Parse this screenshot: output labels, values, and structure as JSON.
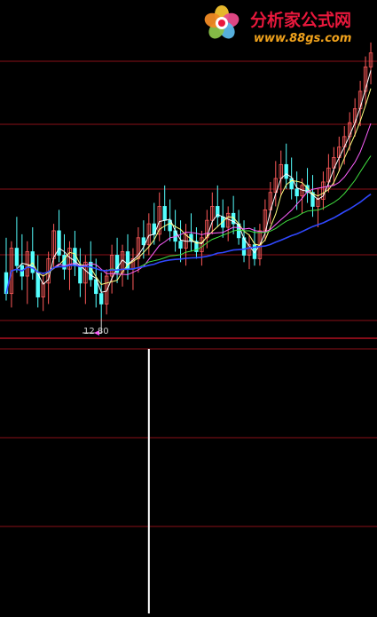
{
  "watermark": {
    "title": "分析家公式网",
    "url": "www.88gs.com",
    "colors": {
      "title": "#e8183c",
      "url": "#f0a21c"
    }
  },
  "chart_data": [
    {
      "type": "candlestick",
      "panel": "price",
      "annotation_low": {
        "value": 12.8,
        "text": "12.80"
      },
      "up_color": "#ff5a5a",
      "down_color": "#54ffff",
      "candles": [
        {
          "o": 14.1,
          "h": 15.1,
          "l": 13.3,
          "c": 13.5
        },
        {
          "o": 13.5,
          "h": 15.0,
          "l": 13.1,
          "c": 14.8
        },
        {
          "o": 14.8,
          "h": 15.7,
          "l": 14.1,
          "c": 14.3
        },
        {
          "o": 14.3,
          "h": 15.2,
          "l": 13.6,
          "c": 14.0
        },
        {
          "o": 14.0,
          "h": 15.0,
          "l": 13.2,
          "c": 14.7
        },
        {
          "o": 14.7,
          "h": 15.4,
          "l": 13.9,
          "c": 14.1
        },
        {
          "o": 14.1,
          "h": 14.6,
          "l": 13.1,
          "c": 13.4
        },
        {
          "o": 13.4,
          "h": 14.1,
          "l": 13.0,
          "c": 13.8
        },
        {
          "o": 13.8,
          "h": 14.7,
          "l": 13.2,
          "c": 14.5
        },
        {
          "o": 14.5,
          "h": 15.5,
          "l": 14.2,
          "c": 15.3
        },
        {
          "o": 15.3,
          "h": 15.9,
          "l": 14.4,
          "c": 14.6
        },
        {
          "o": 14.6,
          "h": 15.2,
          "l": 13.9,
          "c": 14.2
        },
        {
          "o": 14.2,
          "h": 15.0,
          "l": 13.6,
          "c": 14.8
        },
        {
          "o": 14.8,
          "h": 15.3,
          "l": 14.0,
          "c": 14.3
        },
        {
          "o": 14.3,
          "h": 14.8,
          "l": 13.4,
          "c": 13.8
        },
        {
          "o": 13.8,
          "h": 14.6,
          "l": 13.2,
          "c": 14.4
        },
        {
          "o": 14.4,
          "h": 15.0,
          "l": 13.7,
          "c": 13.9
        },
        {
          "o": 13.9,
          "h": 14.5,
          "l": 13.1,
          "c": 13.5
        },
        {
          "o": 13.5,
          "h": 14.1,
          "l": 12.8,
          "c": 13.2
        },
        {
          "o": 13.2,
          "h": 14.2,
          "l": 12.9,
          "c": 14.0
        },
        {
          "o": 14.0,
          "h": 14.9,
          "l": 13.5,
          "c": 14.6
        },
        {
          "o": 14.6,
          "h": 15.1,
          "l": 13.8,
          "c": 14.1
        },
        {
          "o": 14.1,
          "h": 14.9,
          "l": 13.7,
          "c": 14.7
        },
        {
          "o": 14.7,
          "h": 15.2,
          "l": 13.9,
          "c": 14.2
        },
        {
          "o": 14.2,
          "h": 14.8,
          "l": 13.6,
          "c": 14.5
        },
        {
          "o": 14.5,
          "h": 15.4,
          "l": 14.1,
          "c": 15.1
        },
        {
          "o": 15.1,
          "h": 15.6,
          "l": 14.5,
          "c": 14.9
        },
        {
          "o": 14.9,
          "h": 15.8,
          "l": 14.6,
          "c": 15.5
        },
        {
          "o": 15.5,
          "h": 16.1,
          "l": 14.9,
          "c": 15.2
        },
        {
          "o": 15.2,
          "h": 16.4,
          "l": 15.0,
          "c": 16.0
        },
        {
          "o": 16.0,
          "h": 16.6,
          "l": 15.3,
          "c": 15.6
        },
        {
          "o": 15.6,
          "h": 16.2,
          "l": 15.0,
          "c": 15.3
        },
        {
          "o": 15.3,
          "h": 15.9,
          "l": 14.7,
          "c": 15.0
        },
        {
          "o": 15.0,
          "h": 15.6,
          "l": 14.4,
          "c": 14.8
        },
        {
          "o": 14.8,
          "h": 15.5,
          "l": 14.3,
          "c": 15.2
        },
        {
          "o": 15.2,
          "h": 15.8,
          "l": 14.7,
          "c": 15.0
        },
        {
          "o": 15.0,
          "h": 15.4,
          "l": 14.5,
          "c": 14.7
        },
        {
          "o": 14.7,
          "h": 15.3,
          "l": 14.3,
          "c": 15.1
        },
        {
          "o": 15.1,
          "h": 15.9,
          "l": 14.8,
          "c": 15.6
        },
        {
          "o": 15.6,
          "h": 16.4,
          "l": 15.2,
          "c": 16.0
        },
        {
          "o": 16.0,
          "h": 16.6,
          "l": 15.4,
          "c": 15.7
        },
        {
          "o": 15.7,
          "h": 16.2,
          "l": 15.1,
          "c": 15.4
        },
        {
          "o": 15.4,
          "h": 16.0,
          "l": 15.0,
          "c": 15.8
        },
        {
          "o": 15.8,
          "h": 16.3,
          "l": 15.2,
          "c": 15.5
        },
        {
          "o": 15.5,
          "h": 15.9,
          "l": 14.9,
          "c": 15.1
        },
        {
          "o": 15.1,
          "h": 15.6,
          "l": 14.4,
          "c": 14.6
        },
        {
          "o": 14.6,
          "h": 15.2,
          "l": 14.2,
          "c": 14.9
        },
        {
          "o": 14.9,
          "h": 15.4,
          "l": 14.3,
          "c": 14.5
        },
        {
          "o": 14.5,
          "h": 15.5,
          "l": 14.3,
          "c": 15.3
        },
        {
          "o": 15.3,
          "h": 16.2,
          "l": 15.0,
          "c": 15.9
        },
        {
          "o": 15.9,
          "h": 16.7,
          "l": 15.5,
          "c": 16.4
        },
        {
          "o": 16.4,
          "h": 17.3,
          "l": 16.0,
          "c": 16.8
        },
        {
          "o": 16.8,
          "h": 17.6,
          "l": 16.3,
          "c": 17.2
        },
        {
          "o": 17.2,
          "h": 17.8,
          "l": 16.5,
          "c": 16.8
        },
        {
          "o": 16.8,
          "h": 17.4,
          "l": 16.2,
          "c": 16.5
        },
        {
          "o": 16.5,
          "h": 17.0,
          "l": 15.9,
          "c": 16.3
        },
        {
          "o": 16.3,
          "h": 16.8,
          "l": 15.8,
          "c": 16.6
        },
        {
          "o": 16.6,
          "h": 17.1,
          "l": 16.1,
          "c": 16.4
        },
        {
          "o": 16.4,
          "h": 16.9,
          "l": 15.7,
          "c": 16.0
        },
        {
          "o": 16.0,
          "h": 16.5,
          "l": 15.4,
          "c": 16.2
        },
        {
          "o": 16.2,
          "h": 17.0,
          "l": 15.9,
          "c": 16.7
        },
        {
          "o": 16.7,
          "h": 17.5,
          "l": 16.4,
          "c": 17.1
        },
        {
          "o": 17.1,
          "h": 17.7,
          "l": 16.6,
          "c": 17.4
        },
        {
          "o": 17.4,
          "h": 18.0,
          "l": 17.0,
          "c": 17.7
        },
        {
          "o": 17.7,
          "h": 18.3,
          "l": 17.2,
          "c": 18.0
        },
        {
          "o": 18.0,
          "h": 18.7,
          "l": 17.6,
          "c": 18.4
        },
        {
          "o": 18.4,
          "h": 19.1,
          "l": 18.0,
          "c": 18.8
        },
        {
          "o": 18.8,
          "h": 19.6,
          "l": 18.3,
          "c": 19.3
        },
        {
          "o": 19.3,
          "h": 20.3,
          "l": 18.9,
          "c": 20.0
        },
        {
          "o": 20.0,
          "h": 20.7,
          "l": 19.5,
          "c": 20.4
        }
      ],
      "moving_averages": [
        {
          "color": "#ffffff"
        },
        {
          "color": "#ffff80"
        },
        {
          "color": "#ff60ff"
        },
        {
          "color": "#40e040"
        },
        {
          "color": "#3048ff"
        }
      ]
    },
    {
      "type": "bar",
      "panel": "indicator",
      "bar_color": "#ffffff",
      "spike_index": 27,
      "grid_line_color": "#8a1018"
    }
  ]
}
